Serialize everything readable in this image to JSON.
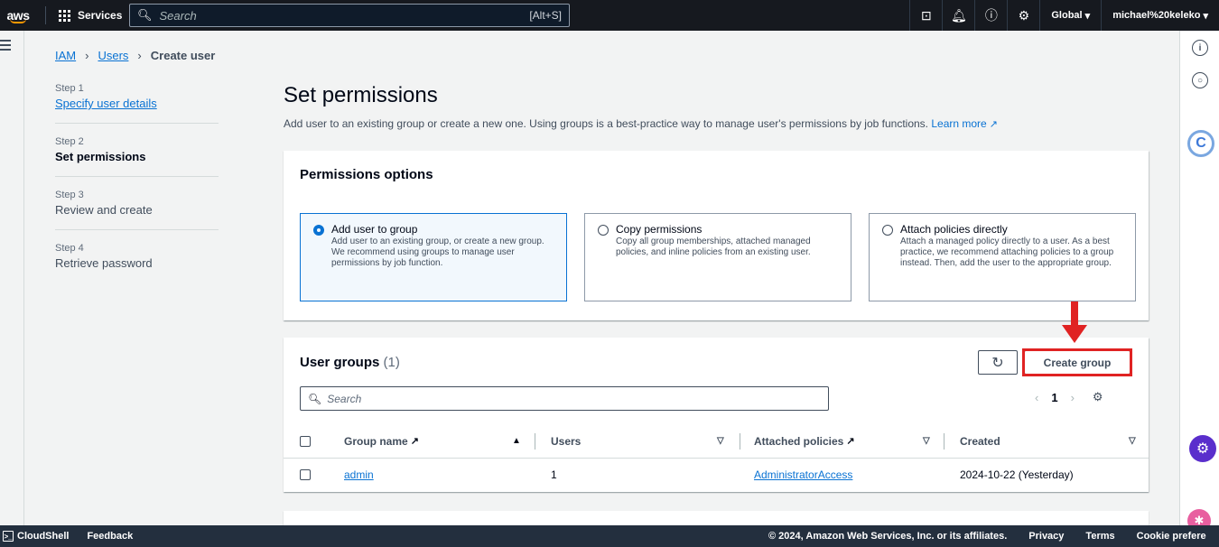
{
  "topnav": {
    "logo": "aws",
    "services": "Services",
    "search_placeholder": "Search",
    "search_shortcut": "[Alt+S]",
    "region": "Global",
    "account": "michael%20keleko"
  },
  "breadcrumb": {
    "items": [
      "IAM",
      "Users"
    ],
    "current": "Create user"
  },
  "steps": [
    {
      "num": "Step 1",
      "title": "Specify user details"
    },
    {
      "num": "Step 2",
      "title": "Set permissions"
    },
    {
      "num": "Step 3",
      "title": "Review and create"
    },
    {
      "num": "Step 4",
      "title": "Retrieve password"
    }
  ],
  "page": {
    "title": "Set permissions",
    "description": "Add user to an existing group or create a new one. Using groups is a best-practice way to manage user's permissions by job functions.",
    "learn_more": "Learn more"
  },
  "permissions": {
    "heading": "Permissions options",
    "options": [
      {
        "label": "Add user to group",
        "desc": "Add user to an existing group, or create a new group. We recommend using groups to manage user permissions by job function.",
        "selected": true
      },
      {
        "label": "Copy permissions",
        "desc": "Copy all group memberships, attached managed policies, and inline policies from an existing user.",
        "selected": false
      },
      {
        "label": "Attach policies directly",
        "desc": "Attach a managed policy directly to a user. As a best practice, we recommend attaching policies to a group instead. Then, add the user to the appropriate group.",
        "selected": false
      }
    ]
  },
  "user_groups": {
    "title": "User groups",
    "count": "(1)",
    "create_label": "Create group",
    "search_placeholder": "Search",
    "page": "1",
    "columns": [
      "Group name",
      "Users",
      "Attached policies",
      "Created"
    ],
    "rows": [
      {
        "name": "admin",
        "users": "1",
        "policies": "AdministratorAccess",
        "created": "2024-10-22 (Yesterday)"
      }
    ],
    "highlight_color": "#e02323"
  },
  "footer": {
    "cloudshell": "CloudShell",
    "feedback": "Feedback",
    "copyright": "© 2024, Amazon Web Services, Inc. or its affiliates.",
    "privacy": "Privacy",
    "terms": "Terms",
    "cookie": "Cookie prefere"
  }
}
